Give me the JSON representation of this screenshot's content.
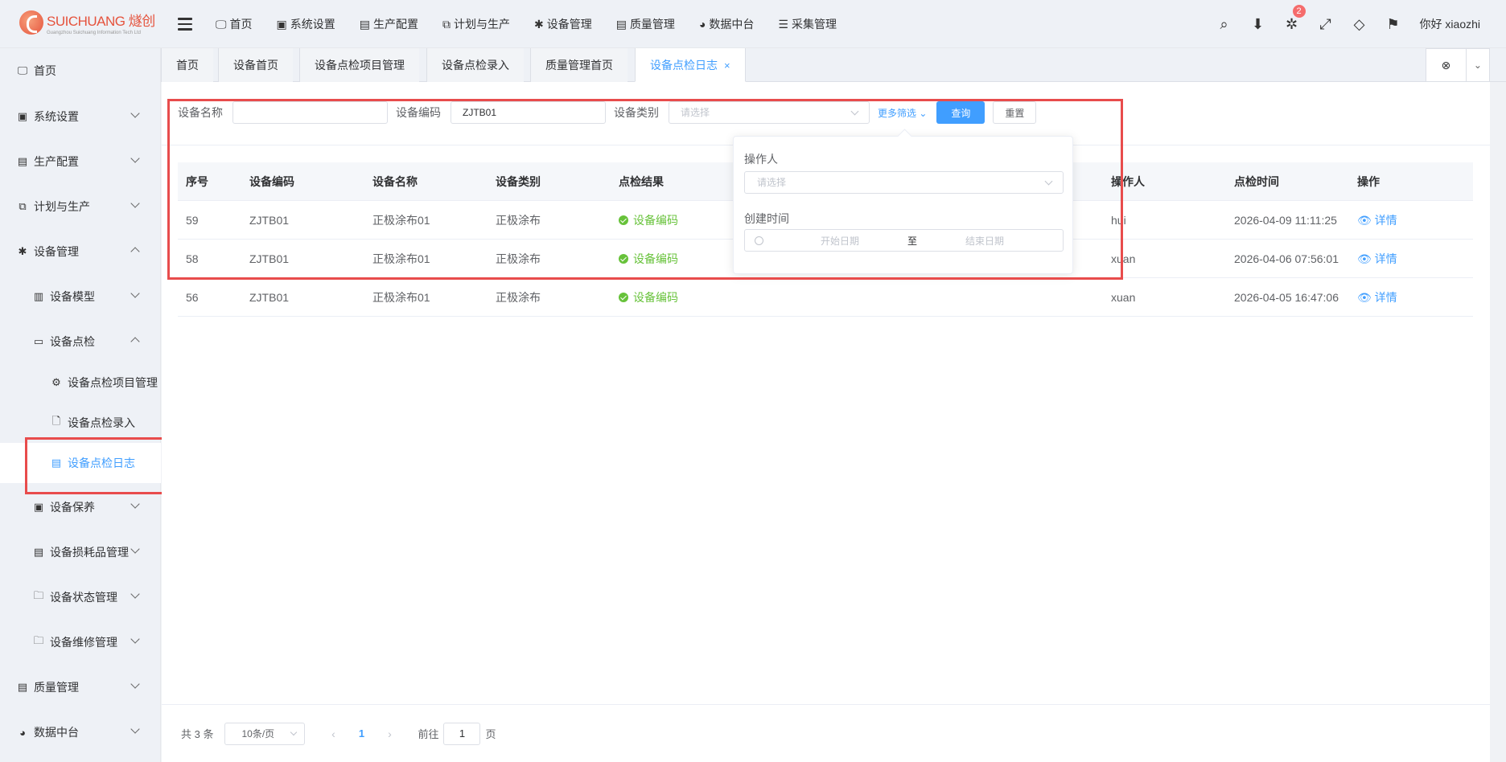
{
  "logo": {
    "main": "SUICHUANG 燧创",
    "sub": "Guangzhou Suichuang Information Tech Ltd"
  },
  "topnav": [
    {
      "label": "首页",
      "icon": "monitor-icon"
    },
    {
      "label": "系统设置",
      "icon": "user-badge-icon"
    },
    {
      "label": "生产配置",
      "icon": "briefcase-icon"
    },
    {
      "label": "计划与生产",
      "icon": "windows-icon"
    },
    {
      "label": "设备管理",
      "icon": "asterisk-icon"
    },
    {
      "label": "质量管理",
      "icon": "briefcase-icon"
    },
    {
      "label": "数据中台",
      "icon": "pie-icon"
    },
    {
      "label": "采集管理",
      "icon": "database-icon"
    }
  ],
  "header": {
    "badge_count": "2",
    "greeting": "你好 xiaozhi"
  },
  "sidebar": {
    "items": [
      {
        "label": "首页"
      },
      {
        "label": "系统设置"
      },
      {
        "label": "生产配置"
      },
      {
        "label": "计划与生产"
      },
      {
        "label": "设备管理"
      },
      {
        "label": "设备模型"
      },
      {
        "label": "设备点检"
      },
      {
        "label": "设备点检项目管理"
      },
      {
        "label": "设备点检录入"
      },
      {
        "label": "设备点检日志"
      },
      {
        "label": "设备保养"
      },
      {
        "label": "设备损耗品管理"
      },
      {
        "label": "设备状态管理"
      },
      {
        "label": "设备维修管理"
      },
      {
        "label": "质量管理"
      },
      {
        "label": "数据中台"
      }
    ]
  },
  "tabs": [
    {
      "label": "首页"
    },
    {
      "label": "设备首页"
    },
    {
      "label": "设备点检项目管理"
    },
    {
      "label": "设备点检录入"
    },
    {
      "label": "质量管理首页"
    },
    {
      "label": "设备点检日志"
    }
  ],
  "tab_close": "×",
  "filters": {
    "name_label": "设备名称",
    "name_value": "",
    "code_label": "设备编码",
    "code_value": "ZJTB01",
    "type_label": "设备类别",
    "type_placeholder": "请选择",
    "more_label": "更多筛选",
    "query_label": "查询",
    "reset_label": "重置"
  },
  "popover": {
    "operator_label": "操作人",
    "operator_placeholder": "请选择",
    "created_label": "创建时间",
    "start_placeholder": "开始日期",
    "range_sep": "至",
    "end_placeholder": "结束日期"
  },
  "table": {
    "headers": {
      "seq": "序号",
      "code": "设备编码",
      "name": "设备名称",
      "type": "设备类别",
      "result": "点检结果",
      "operator": "操作人",
      "time": "点检时间",
      "action": "操作"
    },
    "rows": [
      {
        "seq": "59",
        "code": "ZJTB01",
        "name": "正极涂布01",
        "type": "正极涂布",
        "result": "设备编码",
        "operator": "hui",
        "time": "2026-04-09 11:11:25",
        "action": "详情"
      },
      {
        "seq": "58",
        "code": "ZJTB01",
        "name": "正极涂布01",
        "type": "正极涂布",
        "result": "设备编码",
        "operator": "xuan",
        "time": "2026-04-06 07:56:01",
        "action": "详情"
      },
      {
        "seq": "56",
        "code": "ZJTB01",
        "name": "正极涂布01",
        "type": "正极涂布",
        "result": "设备编码",
        "operator": "xuan",
        "time": "2026-04-05 16:47:06",
        "action": "详情"
      }
    ]
  },
  "pagination": {
    "total": "共 3 条",
    "page_size": "10条/页",
    "current": "1",
    "goto_prefix": "前往",
    "goto_value": "1",
    "goto_suffix": "页"
  },
  "colors": {
    "accent": "#409eff",
    "success": "#67c23a",
    "highlight": "#e84c4c",
    "badge": "#f56c6c"
  }
}
